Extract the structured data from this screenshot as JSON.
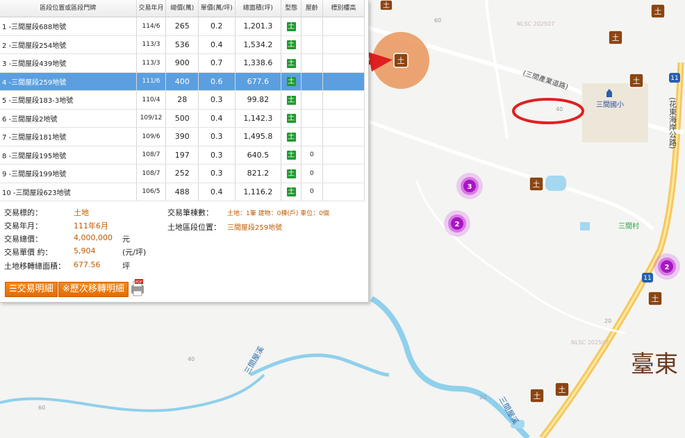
{
  "table": {
    "headers": {
      "location": "區段位置或區段門牌",
      "date": "交易年月",
      "total": "總價(萬)",
      "unit": "單價(萬/坪)",
      "area": "總面積(坪)",
      "type": "型態",
      "age": "屋齡",
      "floor": "標別樓高"
    },
    "rows": [
      {
        "name": "1 -三間屋段688地號",
        "date": "114/6",
        "total": "265",
        "unit": "0.2",
        "area": "1,201.3",
        "type": "土",
        "age": ""
      },
      {
        "name": "2 -三間屋段254地號",
        "date": "113/3",
        "total": "536",
        "unit": "0.4",
        "area": "1,534.2",
        "type": "土",
        "age": ""
      },
      {
        "name": "3 -三間屋段439地號",
        "date": "113/3",
        "total": "900",
        "unit": "0.7",
        "area": "1,338.6",
        "type": "土",
        "age": ""
      },
      {
        "name": "4 -三間屋段259地號",
        "date": "111/6",
        "total": "400",
        "unit": "0.6",
        "area": "677.6",
        "type": "土",
        "age": ""
      },
      {
        "name": "5 -三間屋段183-3地號",
        "date": "110/4",
        "total": "28",
        "unit": "0.3",
        "area": "99.82",
        "type": "土",
        "age": ""
      },
      {
        "name": "6 -三間屋段2地號",
        "date": "109/12",
        "total": "500",
        "unit": "0.4",
        "area": "1,142.3",
        "type": "土",
        "age": ""
      },
      {
        "name": "7 -三間屋段181地號",
        "date": "109/6",
        "total": "390",
        "unit": "0.3",
        "area": "1,495.8",
        "type": "土",
        "age": ""
      },
      {
        "name": "8 -三間屋段195地號",
        "date": "108/7",
        "total": "197",
        "unit": "0.3",
        "area": "640.5",
        "type": "土",
        "age": "0"
      },
      {
        "name": "9 -三間屋段199地號",
        "date": "108/7",
        "total": "252",
        "unit": "0.3",
        "area": "821.2",
        "type": "土",
        "age": "0"
      },
      {
        "name": "10 -三間屋段623地號",
        "date": "106/5",
        "total": "488",
        "unit": "0.4",
        "area": "1,116.2",
        "type": "土",
        "age": "0"
      }
    ]
  },
  "details": {
    "subject_label": "交易標的：",
    "subject": "土地",
    "date_label": "交易年月：",
    "date": "111年6月",
    "total_label": "交易總價：",
    "total": "4,000,000",
    "total_unit": "元",
    "unit_label": "交易單價 約：",
    "unit_price": "5,904",
    "unit_price_unit": "(元/坪)",
    "area_label": "土地移轉總面積：",
    "area": "677.56",
    "area_unit": "坪",
    "count_label": "交易筆棟數：",
    "count": "土地：1筆 建物：0棟(戶) 車位：0個",
    "location_label": "土地區段位置：",
    "location": "三間屋段259地號"
  },
  "buttons": {
    "details": "交易明細",
    "history": "※歷次移轉明細"
  },
  "map": {
    "marker_glyph": "土",
    "road_industrial": "(三間產業道路)",
    "road_highway": "(花東海岸公路)",
    "school": "三間國小",
    "village": "三間村",
    "stream": "三間屋溪",
    "river_label": "三間屋溪",
    "city": "臺東",
    "watermark": "NLSC 202507",
    "highway_shield": "11",
    "elev_40": "40",
    "elev_60": "60",
    "elev_20": "20",
    "clusters": [
      "3",
      "2",
      "2"
    ]
  },
  "colors": {
    "selected_row": "#5b9fe0",
    "land_badge": "#1e9a2d",
    "value_text": "#c05a00",
    "button": "#e56b00",
    "marker": "#8b4513",
    "cluster": "#b51cd0",
    "arrow": "#e02020"
  }
}
